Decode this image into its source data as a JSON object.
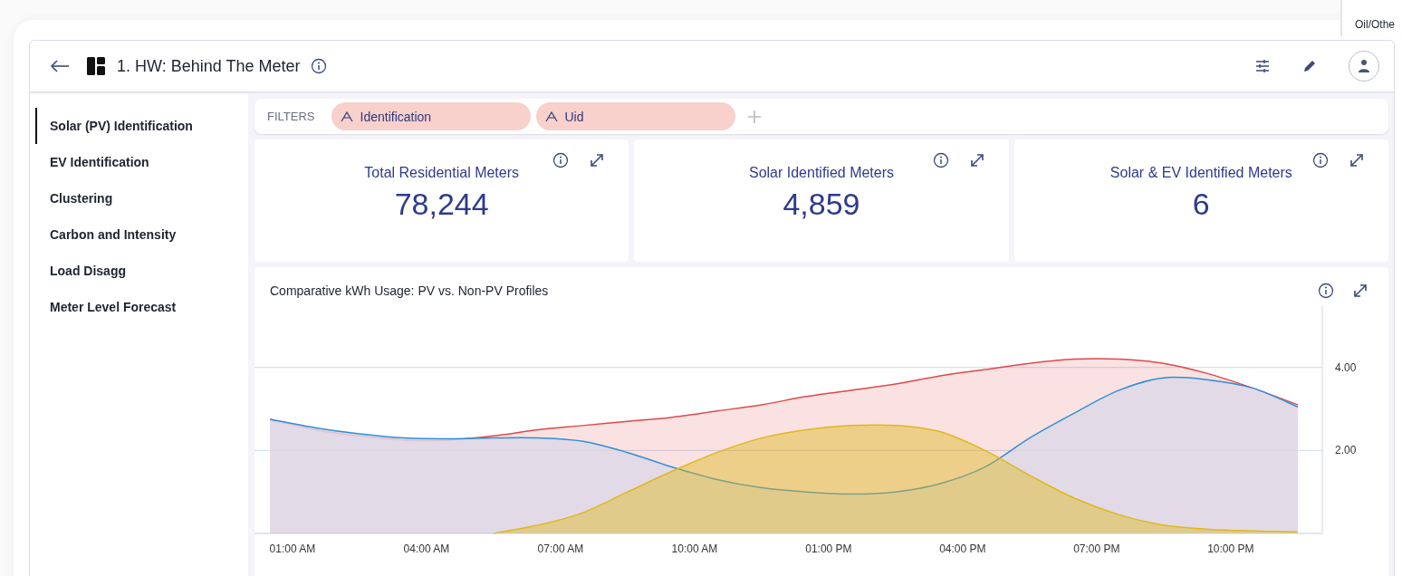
{
  "background_panel": {
    "text": "Oil/Othe"
  },
  "header": {
    "title": "1. HW: Behind The Meter"
  },
  "sidebar": {
    "items": [
      {
        "label": "Solar (PV) Identification",
        "selected": true
      },
      {
        "label": "EV Identification",
        "selected": false
      },
      {
        "label": "Clustering",
        "selected": false
      },
      {
        "label": "Carbon and Intensity",
        "selected": false
      },
      {
        "label": "Load Disagg",
        "selected": false
      },
      {
        "label": "Meter Level Forecast",
        "selected": false
      }
    ]
  },
  "filters": {
    "label": "FILTERS",
    "chips": [
      {
        "label": "Identification"
      },
      {
        "label": "Uid"
      }
    ]
  },
  "kpis": [
    {
      "title": "Total Residential Meters",
      "value": "78,244"
    },
    {
      "title": "Solar Identified Meters",
      "value": "4,859"
    },
    {
      "title": "Solar & EV Identified Meters",
      "value": "6"
    }
  ],
  "chart": {
    "title": "Comparative kWh Usage: PV vs. Non-PV Profiles",
    "chart_data": {
      "type": "area",
      "x": [
        0.5,
        1.5,
        2.5,
        3.5,
        4.5,
        5.5,
        6.5,
        7.5,
        8.5,
        9.5,
        10.5,
        11.5,
        12.5,
        13.5,
        14.5,
        15.5,
        16.5,
        17.5,
        18.5,
        19.5,
        20.5,
        21.5,
        22.5,
        23.5
      ],
      "series": [
        {
          "color": "#e0484a",
          "values": [
            2.75,
            2.5,
            2.35,
            2.25,
            2.25,
            2.35,
            2.5,
            2.6,
            2.7,
            2.8,
            2.95,
            3.1,
            3.3,
            3.45,
            3.6,
            3.8,
            3.95,
            4.1,
            4.2,
            4.2,
            4.1,
            3.85,
            3.5,
            3.1
          ]
        },
        {
          "color": "#2f8fd8",
          "values": [
            2.75,
            2.55,
            2.4,
            2.3,
            2.28,
            2.3,
            2.3,
            2.22,
            1.95,
            1.6,
            1.3,
            1.1,
            1.0,
            0.95,
            1.0,
            1.2,
            1.6,
            2.3,
            2.9,
            3.45,
            3.75,
            3.7,
            3.5,
            3.05
          ]
        },
        {
          "color": "#e0b81c",
          "values": [
            null,
            null,
            null,
            null,
            null,
            0.0,
            0.2,
            0.5,
            1.0,
            1.5,
            1.95,
            2.3,
            2.5,
            2.6,
            2.6,
            2.45,
            2.0,
            1.4,
            0.85,
            0.45,
            0.2,
            0.1,
            0.06,
            0.04
          ]
        }
      ],
      "xlim": [
        0.15,
        24.05
      ],
      "ylim": [
        0,
        5.5
      ],
      "xticks": [
        {
          "value": 1,
          "label": "01:00 AM"
        },
        {
          "value": 4,
          "label": "04:00 AM"
        },
        {
          "value": 7,
          "label": "07:00 AM"
        },
        {
          "value": 10,
          "label": "10:00 AM"
        },
        {
          "value": 13,
          "label": "01:00 PM"
        },
        {
          "value": 16,
          "label": "04:00 PM"
        },
        {
          "value": 19,
          "label": "07:00 PM"
        },
        {
          "value": 22,
          "label": "10:00 PM"
        }
      ],
      "yticks": [
        {
          "value": 2,
          "label": "2.00"
        },
        {
          "value": 4,
          "label": "4.00"
        }
      ]
    }
  }
}
